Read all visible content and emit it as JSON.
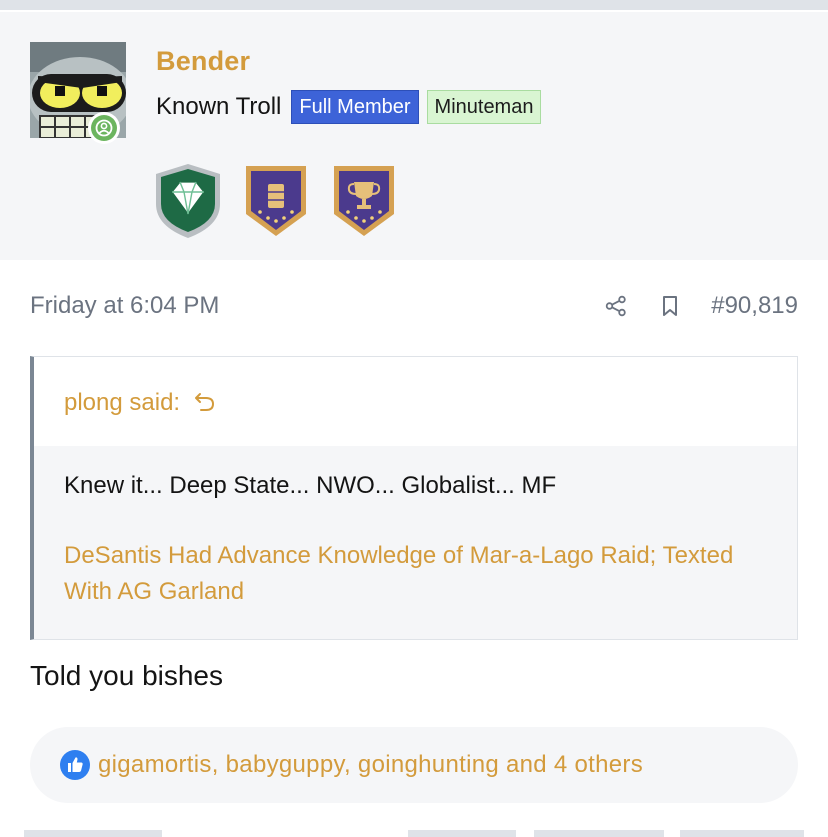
{
  "user": {
    "username": "Bender",
    "title": "Known Troll",
    "banners": [
      "Full Member",
      "Minuteman"
    ],
    "online_status": "online",
    "colors": {
      "username": "#d39b3c",
      "full_member_banner": "#3d63d8",
      "minuteman_banner": "#d9f5d2",
      "online": "#6cb55f"
    },
    "trophies": [
      "diamond-shield-trophy",
      "purple-vest-badge-trophy",
      "purple-cup-badge-trophy"
    ]
  },
  "post": {
    "date": "Friday at 6:04 PM",
    "number": "#90,819",
    "actions": [
      "share-icon",
      "bookmark-icon"
    ],
    "quote": {
      "author": "plong said:",
      "text": "Knew it... Deep State... NWO... Globalist... MF",
      "link_text": "DeSantis Had Advance Knowledge of Mar-a-Lago Raid; Texted With AG Garland"
    },
    "body": "Told you bishes",
    "reactions": {
      "icon": "like-icon",
      "text": "gigamortis, babyguppy, goinghunting and 4 others"
    }
  }
}
